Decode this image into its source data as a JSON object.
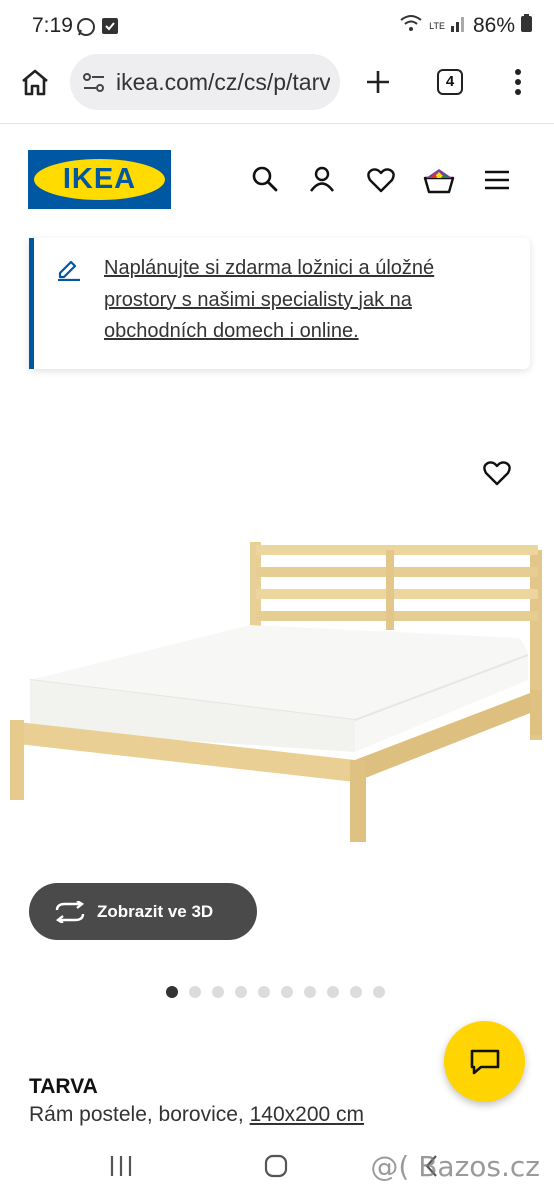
{
  "status_bar": {
    "time": "7:19",
    "battery": "86%",
    "network": "LTE"
  },
  "browser": {
    "url": "ikea.com/cz/cs/p/tarva",
    "tab_count": "4"
  },
  "header": {
    "logo_text": "IKEA"
  },
  "info_card": {
    "text": "Naplánujte si zdarma ložnici a úložné prostory s našimi specialisty jak na obchodních domech i online."
  },
  "product": {
    "view3d_label": "Zobrazit ve 3D",
    "name": "TARVA",
    "description": "Rám postele, borovice,",
    "size": "140x200 cm",
    "gallery_total": 10,
    "gallery_active": 1
  },
  "watermark": "@( Bazos.cz",
  "colors": {
    "ikea_blue": "#0058a3",
    "ikea_yellow": "#ffdb00",
    "fab_yellow": "#ffd400",
    "button_dark": "#4a4a4a"
  }
}
